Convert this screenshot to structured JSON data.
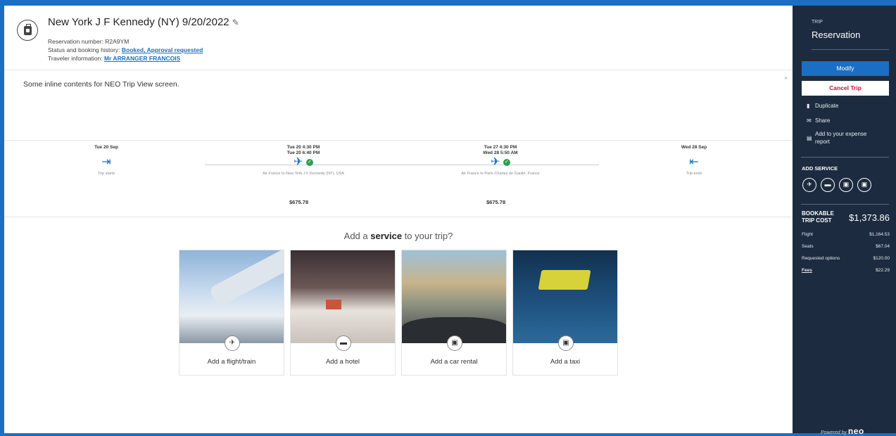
{
  "header": {
    "title": "New York J F Kennedy (NY) 9/20/2022",
    "reservation_label": "Reservation number: ",
    "reservation_value": "R2A9YM",
    "status_label": "Status and booking history: ",
    "status_value": "Booked, Approval requested",
    "traveler_label": "Traveler information: ",
    "traveler_value": "Mr ARRANGER FRANCOIS"
  },
  "inline_contents": "Some inline contents for NEO Trip View screen.",
  "timeline": {
    "start": {
      "date": "Tue 20 Sep",
      "label": "Trip starts"
    },
    "flight1": {
      "dep": "Tue 20  4:30 PM",
      "arr": "Tue 20  6:40 PM",
      "label": "Air France to New York J F Kennedy (NY), USA",
      "price": "$675.78"
    },
    "flight2": {
      "dep": "Tue 27  4:30 PM",
      "arr": "Wed 28  5:50 AM",
      "label": "Air France to Paris Charles de Gaulle, France",
      "price": "$675.78"
    },
    "end": {
      "date": "Wed 28 Sep",
      "label": "Trip ends"
    }
  },
  "services": {
    "title_pre": "Add a ",
    "title_bold": "service",
    "title_post": " to your trip?",
    "cards": [
      {
        "label": "Add a flight/train",
        "icon": "flight-train-icon"
      },
      {
        "label": "Add a hotel",
        "icon": "bed-icon"
      },
      {
        "label": "Add a car rental",
        "icon": "car-icon"
      },
      {
        "label": "Add a taxi",
        "icon": "taxi-icon"
      }
    ]
  },
  "sidebar": {
    "caption": "TRIP",
    "title": "Reservation",
    "modify": "Modify",
    "cancel": "Cancel Trip",
    "duplicate": "Duplicate",
    "share": "Share",
    "expense_line1": "Add to your expense",
    "expense_line2": "report",
    "add_service": "ADD SERVICE",
    "cost_label_1": "BOOKABLE",
    "cost_label_2": "TRIP COST",
    "cost_total": "$1,373.86",
    "rows": [
      {
        "label": "Flight",
        "value": "$1,164.53"
      },
      {
        "label": "Seats",
        "value": "$67.04"
      },
      {
        "label": "Requested options",
        "value": "$120.00"
      },
      {
        "label": "Fees",
        "value": "$22.29"
      }
    ],
    "powered_by": "Powered by",
    "brand": "neo"
  },
  "colors": {
    "accent": "#1a6fc4",
    "sidebar": "#1c2b3f",
    "cancel": "#c8102e",
    "success": "#2e9e4f"
  }
}
